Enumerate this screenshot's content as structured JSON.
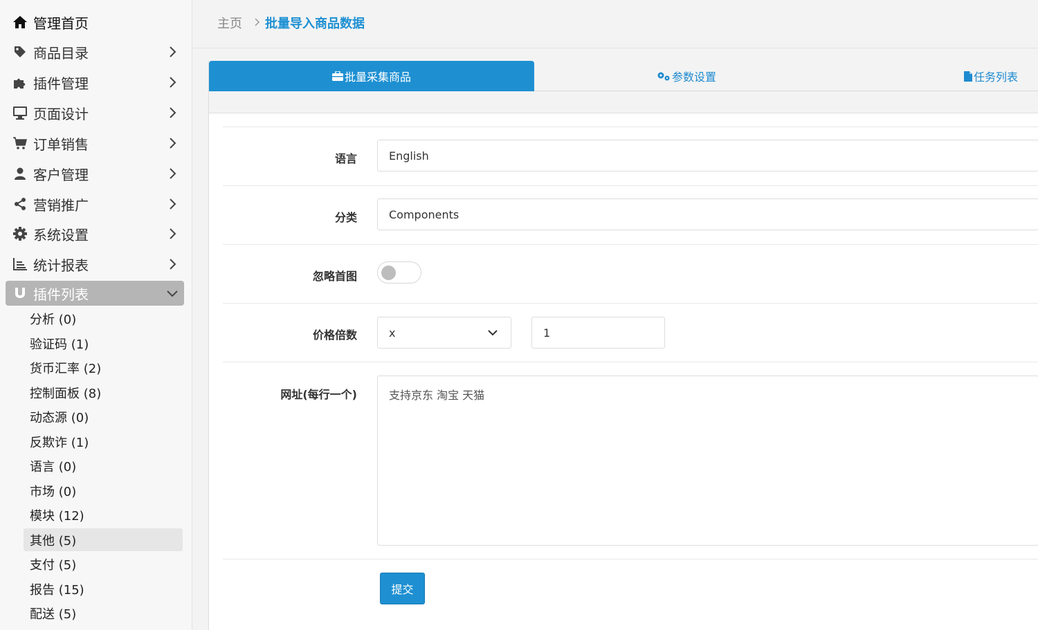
{
  "sidebar": {
    "items": [
      {
        "label": "管理首页",
        "icon": "home-icon"
      },
      {
        "label": "商品目录",
        "icon": "tag-icon"
      },
      {
        "label": "插件管理",
        "icon": "puzzle-icon"
      },
      {
        "label": "页面设计",
        "icon": "monitor-icon"
      },
      {
        "label": "订单销售",
        "icon": "cart-icon"
      },
      {
        "label": "客户管理",
        "icon": "user-icon"
      },
      {
        "label": "营销推广",
        "icon": "share-icon"
      },
      {
        "label": "系统设置",
        "icon": "gear-icon"
      },
      {
        "label": "统计报表",
        "icon": "chart-icon"
      },
      {
        "label": "插件列表",
        "icon": "magnet-icon"
      }
    ],
    "subitems": [
      {
        "label": "分析 (0)"
      },
      {
        "label": "验证码 (1)"
      },
      {
        "label": "货币汇率 (2)"
      },
      {
        "label": "控制面板 (8)"
      },
      {
        "label": "动态源 (0)"
      },
      {
        "label": "反欺诈 (1)"
      },
      {
        "label": "语言 (0)"
      },
      {
        "label": "市场 (0)"
      },
      {
        "label": "模块 (12)"
      },
      {
        "label": "其他 (5)"
      },
      {
        "label": "支付 (5)"
      },
      {
        "label": "报告 (15)"
      },
      {
        "label": "配送 (5)"
      }
    ]
  },
  "breadcrumb": {
    "home": "主页",
    "current": "批量导入商品数据"
  },
  "tabs": [
    {
      "label": "批量采集商品",
      "icon": "briefcase-icon"
    },
    {
      "label": "参数设置",
      "icon": "cogs-icon"
    },
    {
      "label": "任务列表",
      "icon": "file-icon"
    }
  ],
  "form": {
    "language": {
      "label": "语言",
      "value": "English"
    },
    "category": {
      "label": "分类",
      "value": "Components"
    },
    "ignore_first_image": {
      "label": "忽略首图",
      "on": false
    },
    "price_multiplier": {
      "label": "价格倍数",
      "operator": "x",
      "value": "1"
    },
    "urls": {
      "label": "网址(每行一个)",
      "placeholder": "支持京东 淘宝 天猫"
    },
    "submit_label": "提交"
  },
  "colors": {
    "accent": "#1e90d2",
    "active_menu": "#b5b5b5"
  }
}
